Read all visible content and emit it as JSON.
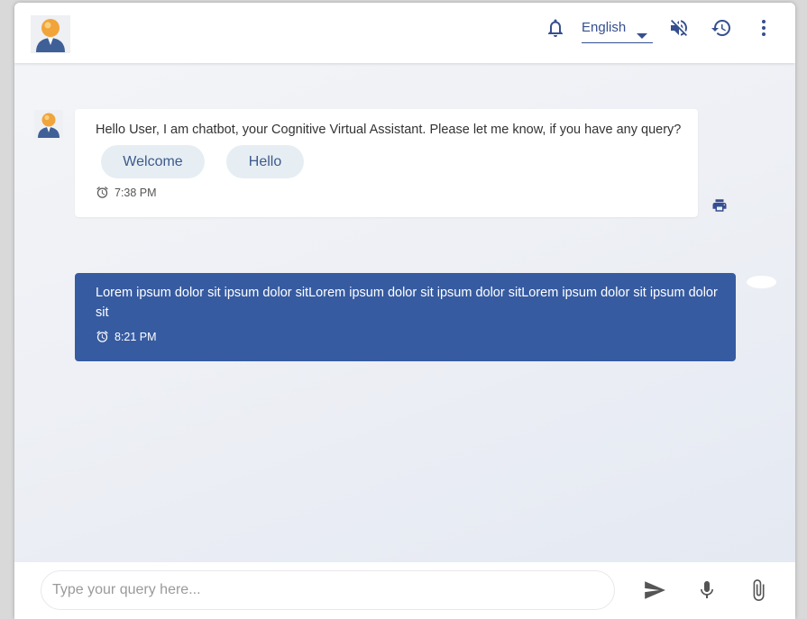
{
  "header": {
    "language": "English",
    "icons": [
      "bot-avatar",
      "bell-icon",
      "language-dropdown",
      "volume-off-icon",
      "history-icon",
      "more-vert-icon"
    ]
  },
  "messages": {
    "bot": {
      "text": "Hello User, I am chatbot, your Cognitive Virtual Assistant. Please let me know, if you have any query?",
      "chips": [
        "Welcome",
        "Hello"
      ],
      "time": "7:38 PM"
    },
    "user": {
      "text": "Lorem ipsum dolor sit ipsum dolor sitLorem ipsum dolor sit ipsum dolor sitLorem ipsum dolor sit ipsum dolor sit",
      "time": "8:21 PM"
    }
  },
  "composer": {
    "placeholder": "Type your query here...",
    "value": ""
  },
  "colors": {
    "primary": "#365ba1",
    "chip_bg": "#e6eef3",
    "chip_text": "#3d5a8c",
    "header_icon": "#354f8f"
  }
}
